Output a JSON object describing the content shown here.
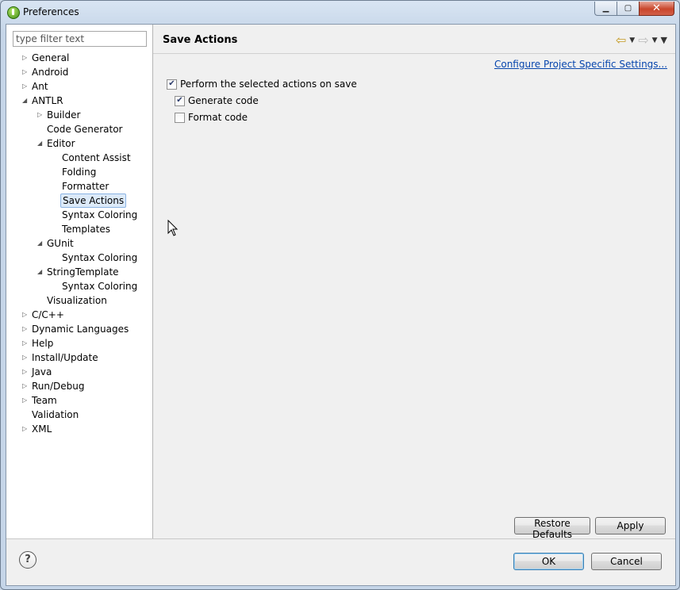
{
  "window": {
    "title": "Preferences"
  },
  "filter": {
    "placeholder": "type filter text"
  },
  "tree": [
    {
      "label": "General",
      "depth": 0,
      "arrow": "collapsed"
    },
    {
      "label": "Android",
      "depth": 0,
      "arrow": "collapsed"
    },
    {
      "label": "Ant",
      "depth": 0,
      "arrow": "collapsed"
    },
    {
      "label": "ANTLR",
      "depth": 0,
      "arrow": "expanded"
    },
    {
      "label": "Builder",
      "depth": 1,
      "arrow": "collapsed"
    },
    {
      "label": "Code Generator",
      "depth": 1,
      "arrow": "none"
    },
    {
      "label": "Editor",
      "depth": 1,
      "arrow": "expanded"
    },
    {
      "label": "Content Assist",
      "depth": 2,
      "arrow": "none"
    },
    {
      "label": "Folding",
      "depth": 2,
      "arrow": "none"
    },
    {
      "label": "Formatter",
      "depth": 2,
      "arrow": "none"
    },
    {
      "label": "Save Actions",
      "depth": 2,
      "arrow": "none",
      "selected": true
    },
    {
      "label": "Syntax Coloring",
      "depth": 2,
      "arrow": "none"
    },
    {
      "label": "Templates",
      "depth": 2,
      "arrow": "none"
    },
    {
      "label": "GUnit",
      "depth": 1,
      "arrow": "expanded"
    },
    {
      "label": "Syntax Coloring",
      "depth": 2,
      "arrow": "none"
    },
    {
      "label": "StringTemplate",
      "depth": 1,
      "arrow": "expanded"
    },
    {
      "label": "Syntax Coloring",
      "depth": 2,
      "arrow": "none"
    },
    {
      "label": "Visualization",
      "depth": 1,
      "arrow": "none"
    },
    {
      "label": "C/C++",
      "depth": 0,
      "arrow": "collapsed"
    },
    {
      "label": "Dynamic Languages",
      "depth": 0,
      "arrow": "collapsed"
    },
    {
      "label": "Help",
      "depth": 0,
      "arrow": "collapsed"
    },
    {
      "label": "Install/Update",
      "depth": 0,
      "arrow": "collapsed"
    },
    {
      "label": "Java",
      "depth": 0,
      "arrow": "collapsed"
    },
    {
      "label": "Run/Debug",
      "depth": 0,
      "arrow": "collapsed"
    },
    {
      "label": "Team",
      "depth": 0,
      "arrow": "collapsed"
    },
    {
      "label": "Validation",
      "depth": 0,
      "arrow": "none"
    },
    {
      "label": "XML",
      "depth": 0,
      "arrow": "collapsed"
    }
  ],
  "page": {
    "title": "Save Actions",
    "config_link": "Configure Project Specific Settings...",
    "options": {
      "perform": {
        "label": "Perform the selected actions on save",
        "checked": true
      },
      "generate": {
        "label": "Generate code",
        "checked": true
      },
      "format": {
        "label": "Format code",
        "checked": false
      }
    },
    "restore_label": "Restore Defaults",
    "apply_label": "Apply"
  },
  "dialog": {
    "ok_label": "OK",
    "cancel_label": "Cancel"
  },
  "icons": {
    "back": "back-arrow-icon",
    "forward": "forward-arrow-icon",
    "help": "help-icon"
  },
  "colors": {
    "link": "#0645ad",
    "selection": "#dceaf9"
  }
}
